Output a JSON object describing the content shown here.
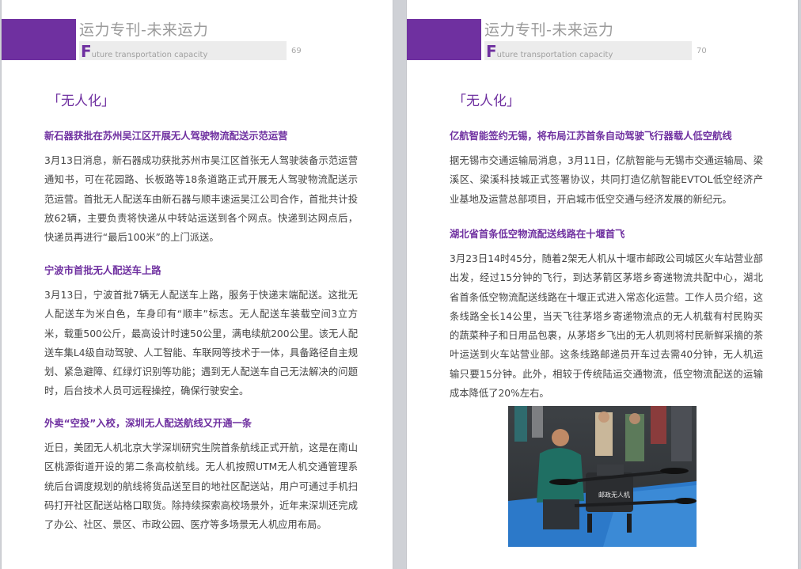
{
  "left_page": {
    "header": {
      "title": "运力专刊-未来运力",
      "subtitle_initial": "F",
      "subtitle_rest": "uture transportation capacity",
      "page_number": "69"
    },
    "section_title": "「无人化」",
    "articles": [
      {
        "title": "新石器获批在苏州吴江区开展无人驾驶物流配送示范运营",
        "body": "3月13日消息，新石器成功获批苏州市吴江区首张无人驾驶装备示范运营通知书，可在花园路、长板路等18条道路正式开展无人驾驶物流配送示范运营。首批无人配送车由新石器与顺丰速运吴江公司合作，首批共计投放62辆，主要负责将快递从中转站运送到各个网点。快递到达网点后，快递员再进行“最后100米”的上门派送。"
      },
      {
        "title": "宁波市首批无人配送车上路",
        "body": "3月13日，宁波首批7辆无人配送车上路，服务于快递末端配送。这批无人配送车为米白色，车身印有“顺丰”标志。无人配送车装载空间3立方米，载重500公斤，最高设计时速50公里，满电续航200公里。该无人配送车集L4级自动驾驶、人工智能、车联网等技术于一体，具备路径自主规划、紧急避障、红绿灯识别等功能；遇到无人配送车自己无法解决的问题时，后台技术人员可远程操控，确保行驶安全。"
      },
      {
        "title": "外卖“空投”入校，深圳无人配送航线又开通一条",
        "body": "近日，美团无人机北京大学深圳研究生院首条航线正式开航，这是在南山区桃源街道开设的第二条高校航线。无人机按照UTM无人机交通管理系统后台调度规划的航线将货品送至目的地社区配送站，用户可通过手机扫码打开社区配送站格口取货。除持续探索高校场景外，近年来深圳还完成了办公、社区、景区、市政公园、医疗等多场景无人机应用布局。"
      }
    ]
  },
  "right_page": {
    "header": {
      "title": "运力专刊-未来运力",
      "subtitle_initial": "F",
      "subtitle_rest": "uture transportation capacity",
      "page_number": "70"
    },
    "section_title": "「无人化」",
    "articles": [
      {
        "title": "亿航智能签约无锡，将布局江苏首条自动驾驶飞行器载人低空航线",
        "body": "据无锡市交通运输局消息，3月11日，亿航智能与无锡市交通运输局、梁溪区、梁溪科技城正式签署协议，共同打造亿航智能EVTOL低空经济产业基地及运营总部项目，开启城市低空交通与经济发展的新纪元。"
      },
      {
        "title": "湖北省首条低空物流配送线路在十堰首飞",
        "body": "3月23日14时45分，随着2架无人机从十堰市邮政公司城区火车站营业部出发，经过15分钟的飞行，到达茅箭区茅塔乡寄递物流共配中心，湖北省首条低空物流配送线路在十堰正式进入常态化运营。工作人员介绍，这条线路全长14公里，当天飞往茅塔乡寄递物流点的无人机载有村民购买的蔬菜种子和日用品包裹，从茅塔乡飞出的无人机则将村民新鲜采摘的茶叶运送到火车站营业部。这条线路邮递员开车过去需40分钟，无人机运输只要15分钟。此外，相较于传统陆运交通物流，低空物流配送的运输成本降低了20%左右。"
      }
    ],
    "photo": {
      "drone_label": "邮政无人机"
    }
  },
  "colors": {
    "accent": "#6f30a0",
    "header_gray": "#9a9a9a",
    "body_text": "#444444",
    "background": "#cfd1d6"
  }
}
